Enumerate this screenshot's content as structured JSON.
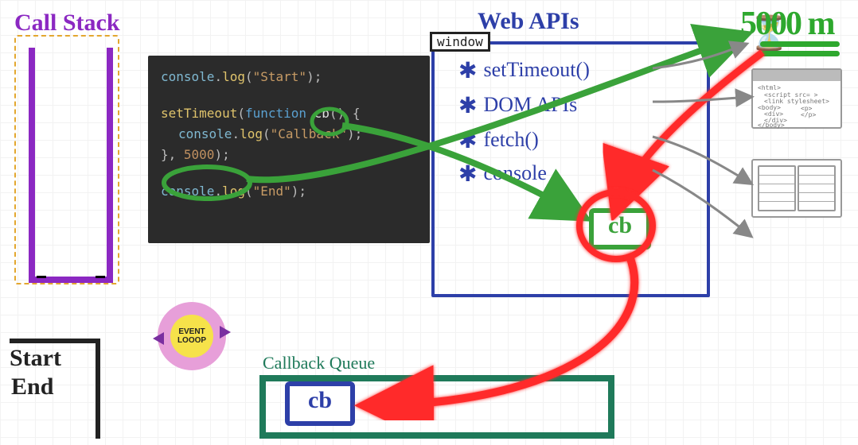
{
  "call_stack": {
    "label": "Call Stack"
  },
  "code": {
    "lines": {
      "l1_obj": "console",
      "l1_fn": "log",
      "l1_str": "\"Start\"",
      "l2_fn": "setTimeout",
      "l2_kw": "function",
      "l2_id": "cb",
      "l3_obj": "console",
      "l3_fn": "log",
      "l3_str": "\"Callback\"",
      "l4_num": "5000",
      "l5_obj": "console",
      "l5_fn": "log",
      "l5_str": "\"End\""
    }
  },
  "web_apis": {
    "label": "Web APIs",
    "window_tab": "window",
    "items": [
      "setTimeout()",
      "DOM APIs",
      "fetch()",
      "console"
    ]
  },
  "timer": {
    "label": "5000 m"
  },
  "callback_chip": {
    "web": "cb",
    "queue": "cb"
  },
  "callback_queue": {
    "label": "Callback Queue"
  },
  "event_loop": {
    "label": "EVENT LOOOP"
  },
  "output": {
    "line1": "Start",
    "line2": "End"
  },
  "browser_sketch": {
    "t1": "<html>",
    "t2": "<script src= >",
    "t3": "<link stylesheet>",
    "t4": "<body>",
    "t5": "<div>",
    "t6": "<p>",
    "t7": "</p>",
    "t8": "</div>",
    "t9": "</body>"
  }
}
